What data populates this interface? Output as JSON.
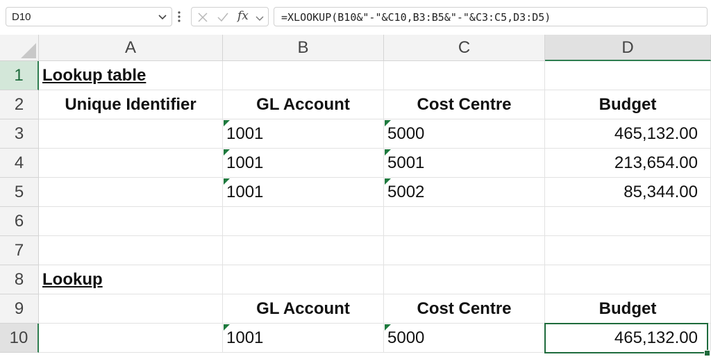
{
  "formula_bar": {
    "name_box": "D10",
    "fx_label": "fx",
    "formula": "=XLOOKUP(B10&\"-\"&C10,B3:B5&\"-\"&C3:C5,D3:D5)"
  },
  "sheet": {
    "columns": [
      "A",
      "B",
      "C",
      "D"
    ],
    "selected_column": "D",
    "rows": [
      "1",
      "2",
      "3",
      "4",
      "5",
      "6",
      "7",
      "8",
      "9",
      "10"
    ],
    "selected_row": "10",
    "cells": {
      "A1": "Lookup table",
      "A2": "Unique Identifier",
      "B2": "GL Account",
      "C2": "Cost Centre",
      "D2": "Budget",
      "B3": "1001",
      "C3": "5000",
      "D3": "465,132.00",
      "B4": "1001",
      "C4": "5001",
      "D4": "213,654.00",
      "B5": "1001",
      "C5": "5002",
      "D5": "85,344.00",
      "A8": "Lookup",
      "B9": "GL Account",
      "C9": "Cost Centre",
      "D9": "Budget",
      "B10": "1001",
      "C10": "5000",
      "D10": "465,132.00"
    },
    "accent_color": "#1e6b3c"
  }
}
